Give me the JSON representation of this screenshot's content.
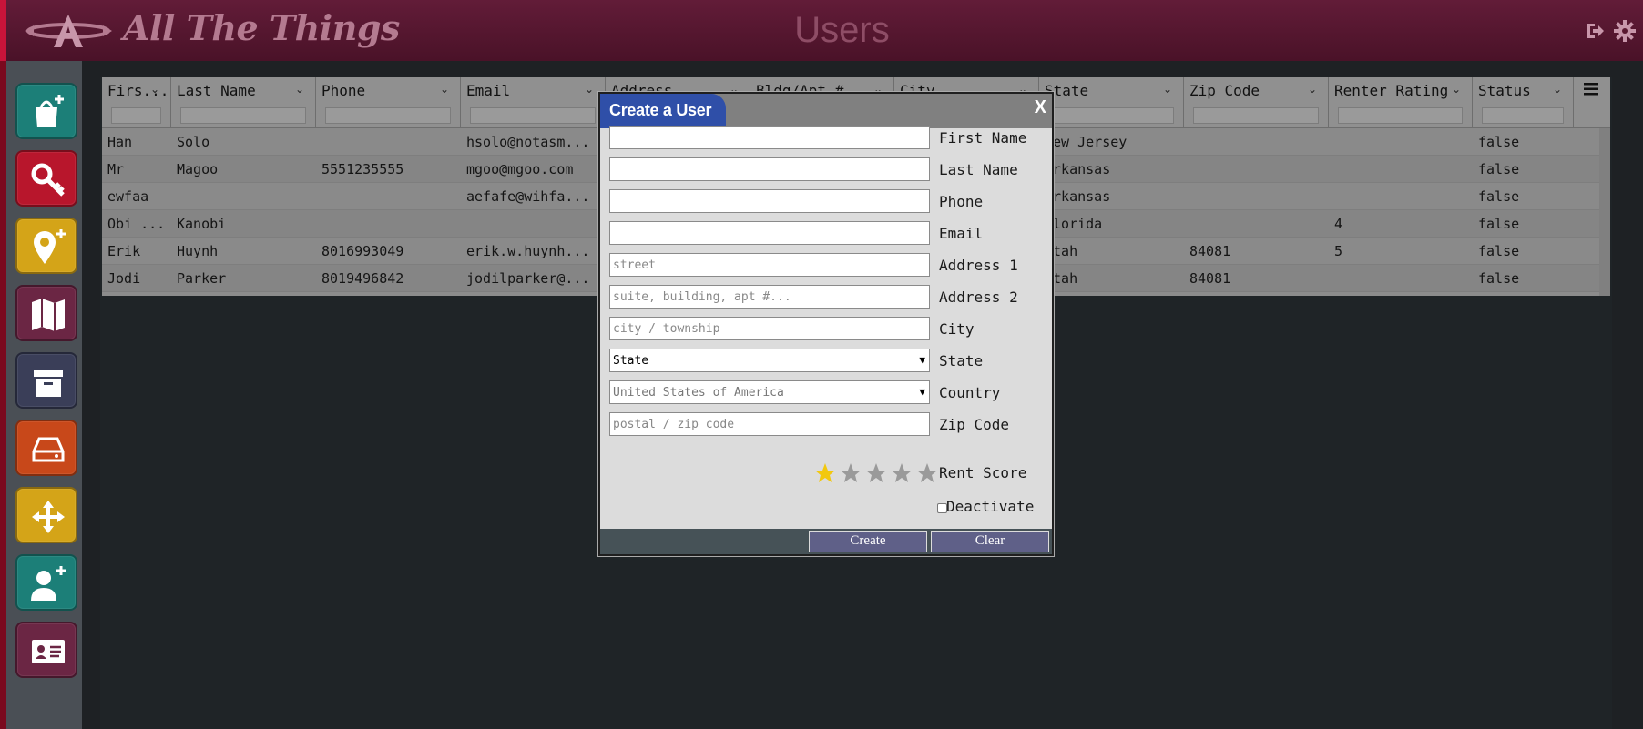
{
  "header": {
    "app_title": "All The Things",
    "page_title": "Users",
    "logo_icon": "atom-a-logo",
    "logout_icon": "logout-icon",
    "settings_icon": "gear-icon"
  },
  "sidebar": {
    "items": [
      {
        "name": "add-product-icon",
        "color": "#1c7f78"
      },
      {
        "name": "key-icon",
        "color": "#b8162c"
      },
      {
        "name": "add-location-icon",
        "color": "#d4a418"
      },
      {
        "name": "map-icon",
        "color": "#6b2644"
      },
      {
        "name": "archive-icon",
        "color": "#3a3e58"
      },
      {
        "name": "storage-drive-icon",
        "color": "#c8481a"
      },
      {
        "name": "move-arrows-icon",
        "color": "#d4a418"
      },
      {
        "name": "add-user-icon",
        "color": "#1c7f78"
      },
      {
        "name": "id-card-icon",
        "color": "#6b2644"
      }
    ]
  },
  "grid": {
    "columns": [
      "First Name",
      "Last Name",
      "Phone",
      "Email",
      "Address",
      "Bldg/Apt #",
      "City",
      "State",
      "Zip Code",
      "Renter Rating",
      "Status"
    ],
    "column_display": [
      "Firs...",
      "Last Name",
      "Phone",
      "Email",
      "Address",
      "Bldg/Apt #",
      "City",
      "State",
      "Zip Code",
      "Renter Rating",
      "Status"
    ],
    "rows": [
      [
        "Han",
        "Solo",
        "",
        "hsolo@notasm...",
        "",
        "",
        "",
        "New Jersey",
        "",
        "",
        "false"
      ],
      [
        "Mr",
        "Magoo",
        "5551235555",
        "mgoo@mgoo.com",
        "",
        "",
        "",
        "Arkansas",
        "",
        "",
        "false"
      ],
      [
        "ewfaa",
        "",
        "",
        "aefafe@wihfa...",
        "",
        "",
        "",
        "Arkansas",
        "",
        "",
        "false"
      ],
      [
        "Obi ...",
        "Kanobi",
        "",
        "",
        "",
        "",
        "",
        "Florida",
        "",
        "4",
        "false"
      ],
      [
        "Erik",
        "Huynh",
        "8016993049",
        "erik.w.huynh...",
        "",
        "",
        "",
        "Utah",
        "84081",
        "5",
        "false"
      ],
      [
        "Jodi",
        "Parker",
        "8019496842",
        "jodilparker@...",
        "",
        "",
        "",
        "Utah",
        "84081",
        "",
        "false"
      ]
    ],
    "menu_icon": "hamburger-menu-icon"
  },
  "modal": {
    "title": "Create a User",
    "close_label": "X",
    "fields": [
      {
        "label": "First Name",
        "value": "",
        "placeholder": ""
      },
      {
        "label": "Last Name",
        "value": "",
        "placeholder": ""
      },
      {
        "label": "Phone",
        "value": "",
        "placeholder": ""
      },
      {
        "label": "Email",
        "value": "",
        "placeholder": ""
      },
      {
        "label": "Address 1",
        "value": "",
        "placeholder": "street"
      },
      {
        "label": "Address 2",
        "value": "",
        "placeholder": "suite, building, apt #..."
      },
      {
        "label": "City",
        "value": "",
        "placeholder": "city / township"
      },
      {
        "label": "State",
        "selected": "State"
      },
      {
        "label": "Country",
        "selected": "United States of America"
      },
      {
        "label": "Zip Code",
        "value": "",
        "placeholder": "postal / zip code"
      }
    ],
    "rent_score_label": "Rent Score",
    "rent_score": 1,
    "rent_score_max": 5,
    "deactivate_label": "Deactivate",
    "deactivate_checked": false,
    "create_label": "Create",
    "clear_label": "Clear",
    "colors": {
      "tab": "#2f4fa8",
      "button": "#5f6088",
      "star_on": "#f2c80f",
      "star_off": "#9a9a9a"
    }
  }
}
